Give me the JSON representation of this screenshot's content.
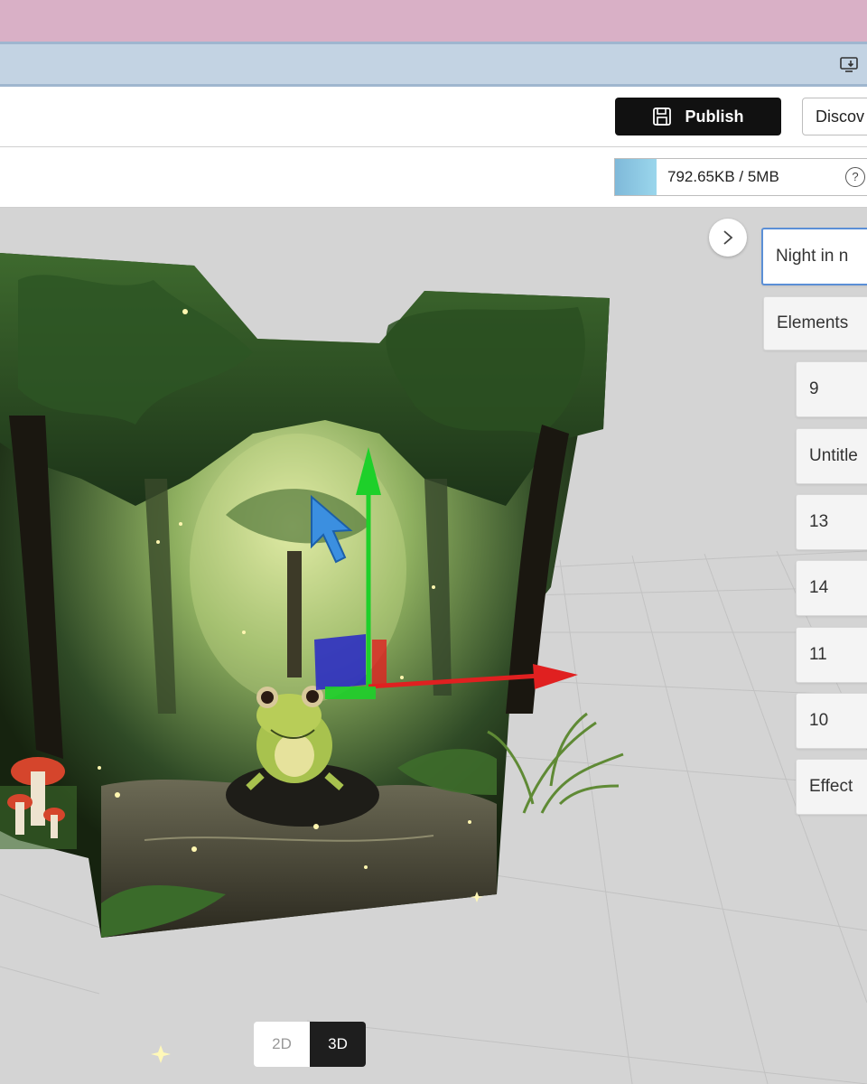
{
  "toolbar": {
    "publish_label": "Publish",
    "discover_label": "Discov"
  },
  "storage": {
    "usage_text": "792.65KB / 5MB",
    "fraction_used": 0.155,
    "help_symbol": "?"
  },
  "panel": {
    "collapse_icon": "chevron-right-icon",
    "items": [
      {
        "label": "Night in n",
        "selected": true
      },
      {
        "label": "Elements"
      },
      {
        "label": "9"
      },
      {
        "label": "Untitle"
      },
      {
        "label": "13"
      },
      {
        "label": "14"
      },
      {
        "label": "11"
      },
      {
        "label": "10"
      },
      {
        "label": "Effect"
      }
    ]
  },
  "view_toggle": {
    "label_2d": "2D",
    "label_3d": "3D",
    "active": "3D"
  },
  "colors": {
    "accent_selected": "#5b8fd6",
    "gizmo_x": "#e02020",
    "gizmo_y": "#1ed02a",
    "gizmo_z": "#2626c8",
    "cursor": "#3b8fe0"
  }
}
